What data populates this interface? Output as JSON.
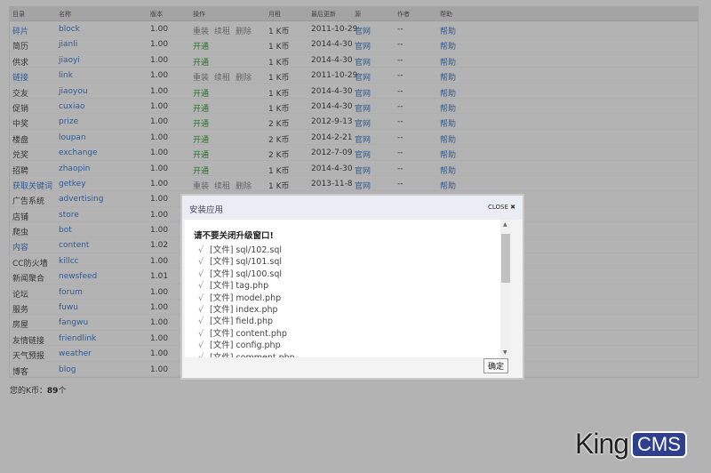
{
  "table": {
    "headers": [
      "目录",
      "名称",
      "版本",
      "操作",
      "月租",
      "最后更新",
      "源",
      "作者",
      "帮助"
    ],
    "rows": [
      {
        "dir": "碎片",
        "dir_link": true,
        "name": "block",
        "ver": "1.00",
        "ops": [
          "重装",
          "续租",
          "删除"
        ],
        "rent": "1 K币",
        "updated": "2011-10-29",
        "src": "官网",
        "author": "--",
        "help": "帮助"
      },
      {
        "dir": "简历",
        "name": "jianli",
        "ver": "1.00",
        "ops": [
          "开通"
        ],
        "rent": "1 K币",
        "updated": "2014-4-30",
        "src": "官网",
        "author": "--",
        "help": "帮助"
      },
      {
        "dir": "供求",
        "name": "jiaoyi",
        "ver": "1.00",
        "ops": [
          "开通"
        ],
        "rent": "1 K币",
        "updated": "2014-4-30",
        "src": "官网",
        "author": "--",
        "help": "帮助"
      },
      {
        "dir": "链接",
        "dir_link": true,
        "name": "link",
        "ver": "1.00",
        "ops": [
          "重装",
          "续租",
          "删除"
        ],
        "rent": "1 K币",
        "updated": "2011-10-29",
        "src": "官网",
        "author": "--",
        "help": "帮助"
      },
      {
        "dir": "交友",
        "name": "jiaoyou",
        "ver": "1.00",
        "ops": [
          "开通"
        ],
        "rent": "1 K币",
        "updated": "2014-4-30",
        "src": "官网",
        "author": "--",
        "help": "帮助"
      },
      {
        "dir": "促销",
        "name": "cuxiao",
        "ver": "1.00",
        "ops": [
          "开通"
        ],
        "rent": "1 K币",
        "updated": "2014-4-30",
        "src": "官网",
        "author": "--",
        "help": "帮助"
      },
      {
        "dir": "中奖",
        "name": "prize",
        "ver": "1.00",
        "ops": [
          "开通"
        ],
        "rent": "2 K币",
        "updated": "2012-9-13",
        "src": "官网",
        "author": "--",
        "help": "帮助"
      },
      {
        "dir": "楼盘",
        "name": "loupan",
        "ver": "1.00",
        "ops": [
          "开通"
        ],
        "rent": "2 K币",
        "updated": "2014-2-21",
        "src": "官网",
        "author": "--",
        "help": "帮助"
      },
      {
        "dir": "兑奖",
        "name": "exchange",
        "ver": "1.00",
        "ops": [
          "开通"
        ],
        "rent": "2 K币",
        "updated": "2012-7-09",
        "src": "官网",
        "author": "--",
        "help": "帮助"
      },
      {
        "dir": "招聘",
        "name": "zhaopin",
        "ver": "1.00",
        "ops": [
          "开通"
        ],
        "rent": "1 K币",
        "updated": "2014-4-30",
        "src": "官网",
        "author": "--",
        "help": "帮助"
      },
      {
        "dir": "获取关键词",
        "dir_link": true,
        "name": "getkey",
        "ver": "1.00",
        "ops": [
          "重装",
          "续租",
          "删除"
        ],
        "rent": "1 K币",
        "updated": "2013-11-8",
        "src": "官网",
        "author": "--",
        "help": "帮助"
      },
      {
        "dir": "广告系统",
        "name": "advertising",
        "ver": "1.00"
      },
      {
        "dir": "店铺",
        "name": "store",
        "ver": "1.00"
      },
      {
        "dir": "爬虫",
        "name": "bot",
        "ver": "1.00"
      },
      {
        "dir": "内容",
        "dir_link": true,
        "name": "content",
        "ver": "1.02"
      },
      {
        "dir": "CC防火墙",
        "name": "killcc",
        "ver": "1.00"
      },
      {
        "dir": "新闻聚合",
        "name": "newsfeed",
        "ver": "1.01"
      },
      {
        "dir": "论坛",
        "name": "forum",
        "ver": "1.00"
      },
      {
        "dir": "服务",
        "name": "fuwu",
        "ver": "1.00"
      },
      {
        "dir": "房屋",
        "name": "fangwu",
        "ver": "1.00"
      },
      {
        "dir": "友情链接",
        "name": "friendlink",
        "ver": "1.00"
      },
      {
        "dir": "天气预报",
        "name": "weather",
        "ver": "1.00"
      },
      {
        "dir": "博客",
        "name": "blog",
        "ver": "1.00"
      }
    ]
  },
  "balance": {
    "label": "您的K币：",
    "value": "89",
    "unit": "个"
  },
  "modal": {
    "title": "安装应用",
    "close": "CLOSE ✖",
    "warning": "请不要关闭升级窗口!",
    "check": "√",
    "files": [
      "[文件] sql/102.sql",
      "[文件] sql/101.sql",
      "[文件] sql/100.sql",
      "[文件] tag.php",
      "[文件] model.php",
      "[文件] index.php",
      "[文件] field.php",
      "[文件] content.php",
      "[文件] config.php",
      "[文件] comment.php"
    ],
    "ok": "确定"
  },
  "logo": {
    "king": "King",
    "cms": "CMS"
  },
  "colors": {
    "link": "#2f5a95",
    "open": "#1d7a1d",
    "logo_badge": "#2e3f8f"
  }
}
